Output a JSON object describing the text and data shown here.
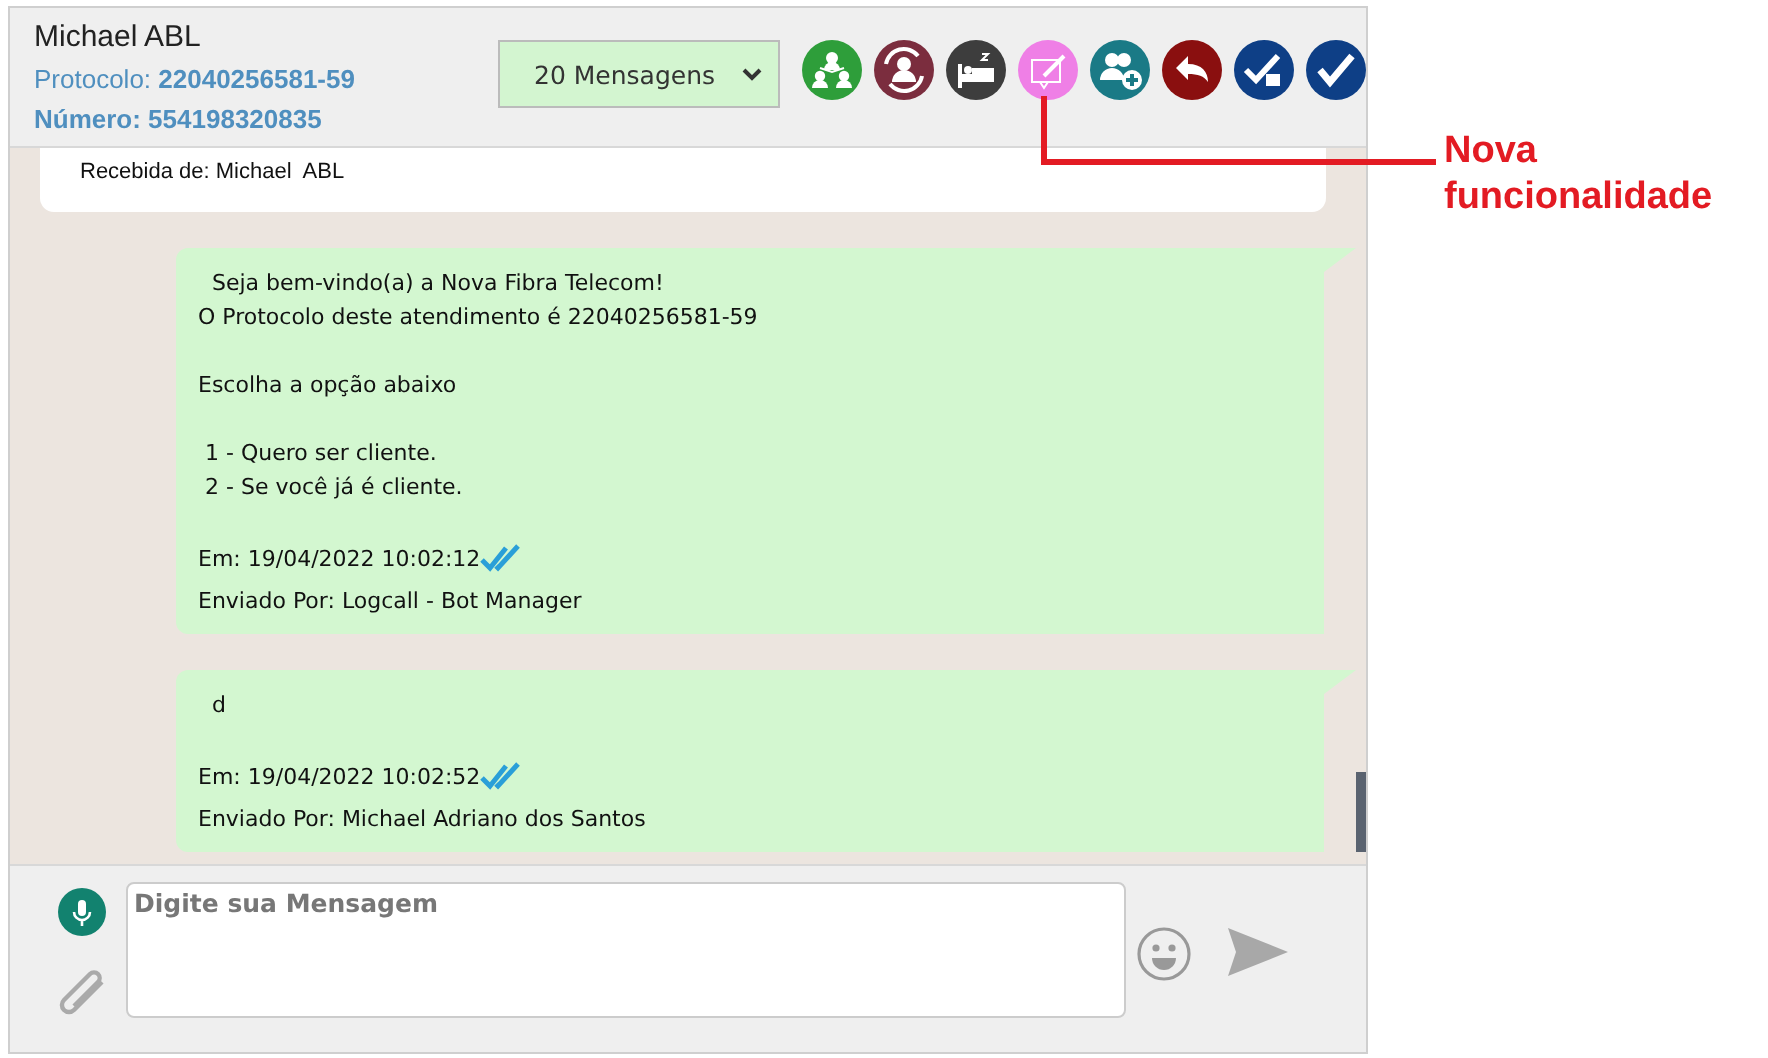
{
  "header": {
    "name": "Michael ABL",
    "protocol": "Protocolo: **22040256581-59**",
    "number": "Número: 554198320835",
    "message_count": "20 Mensagens"
  },
  "messages": [
    {
      "kind": "received",
      "sender": "Recebida de: Michael  ABL"
    },
    {
      "kind": "sent",
      "paragraphs": [
        [
          "  Seja bem-vindo(a) a Nova Fibra Telecom!",
          "O Protocolo deste atendimento é 22040256581-59"
        ],
        [
          "Escolha a opção abaixo"
        ],
        [
          " 1 - Quero ser cliente.",
          " 2 - Se você já é cliente."
        ]
      ],
      "time": "Em: 19/04/2022 10:02:12",
      "read": true,
      "sender": "Enviado Por: Logcall - Bot Manager"
    },
    {
      "kind": "sent",
      "paragraphs": [
        [
          "  d"
        ]
      ],
      "time": "Em: 19/04/2022 10:02:52",
      "read": true,
      "sender": "Enviado Por: Michael Adriano dos Santos"
    }
  ],
  "composer": {
    "placeholder": "Digite sua Mensagem"
  },
  "annotation": {
    "text": "Nova funcionalidade"
  }
}
